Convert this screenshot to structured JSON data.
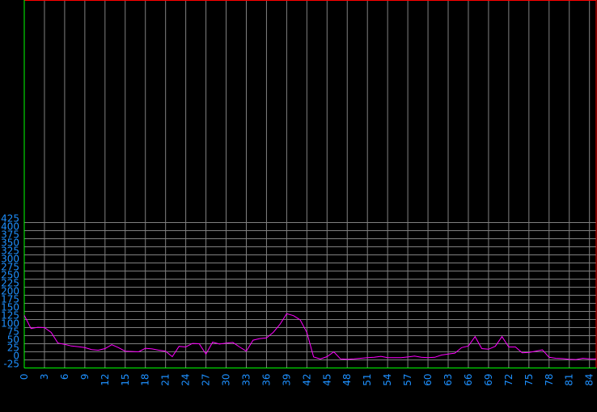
{
  "chart_data": {
    "type": "line",
    "x": [
      0,
      1,
      2,
      3,
      4,
      5,
      6,
      7,
      8,
      9,
      10,
      11,
      12,
      13,
      14,
      15,
      16,
      17,
      18,
      19,
      20,
      21,
      22,
      23,
      24,
      25,
      26,
      27,
      28,
      29,
      30,
      31,
      32,
      33,
      34,
      35,
      36,
      37,
      38,
      39,
      40,
      41,
      42,
      43,
      44,
      45,
      46,
      47,
      48,
      49,
      50,
      51,
      52,
      53,
      54,
      55,
      56,
      57,
      58,
      59,
      60,
      61,
      62,
      63,
      64,
      65,
      66,
      67,
      68,
      69,
      70,
      71,
      72,
      73,
      74,
      75,
      76,
      77,
      78,
      79,
      80,
      81,
      82,
      83,
      84,
      85
    ],
    "series": [
      {
        "values": [
          138,
          97,
          101,
          100,
          85,
          52,
          48,
          43,
          41,
          38,
          32,
          30,
          35,
          47,
          38,
          27,
          26,
          25,
          36,
          34,
          30,
          27,
          10,
          42,
          40,
          51,
          50,
          18,
          55,
          49,
          52,
          54,
          40,
          27,
          61,
          66,
          68,
          85,
          110,
          143,
          137,
          124,
          85,
          9,
          3,
          10,
          25,
          3,
          2,
          3,
          5,
          7,
          8,
          11,
          7,
          7,
          7,
          9,
          12,
          8,
          7,
          8,
          15,
          18,
          21,
          38,
          43,
          72,
          35,
          33,
          42,
          72,
          40,
          40,
          22,
          23,
          27,
          31,
          8,
          5,
          4,
          2,
          1,
          5,
          3,
          3
        ],
        "color": "#ff00ff"
      }
    ],
    "xlim": [
      0,
      85
    ],
    "ylim": [
      -25,
      440
    ],
    "y_ticks": [
      -25,
      0,
      25,
      50,
      75,
      100,
      125,
      150,
      175,
      200,
      225,
      250,
      275,
      300,
      325,
      350,
      375,
      400,
      425
    ],
    "x_ticks": [
      0,
      3,
      6,
      9,
      12,
      15,
      18,
      21,
      24,
      27,
      30,
      33,
      36,
      39,
      42,
      45,
      48,
      51,
      54,
      57,
      60,
      63,
      66,
      69,
      72,
      75,
      78,
      81,
      84
    ],
    "grid": true,
    "colors": {
      "background": "#000000",
      "grid": "#808080",
      "tick_label": "#1e90ff",
      "frame_top": "#ff0000",
      "frame_bottom": "#00ff00"
    }
  }
}
